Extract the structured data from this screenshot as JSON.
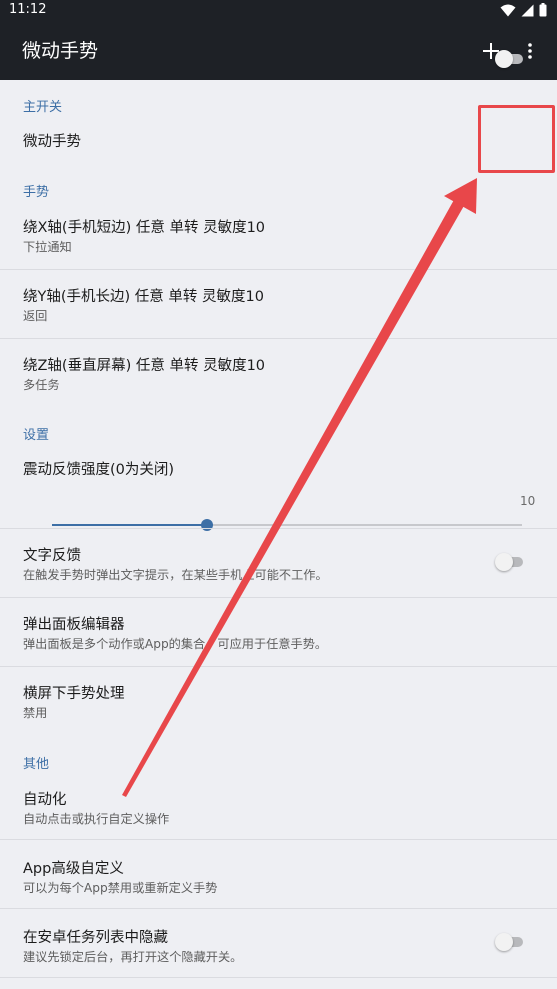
{
  "status_bar": {
    "time": "11:12",
    "icons": [
      "wifi-icon",
      "signal-icon",
      "battery-icon"
    ]
  },
  "app_bar": {
    "title": "微动手势",
    "actions": [
      "add-icon",
      "more-vert-icon"
    ]
  },
  "sections": {
    "main_switch": "主开关",
    "gestures": "手势",
    "settings": "设置",
    "other": "其他"
  },
  "main_switch": {
    "title": "微动手势",
    "on": false
  },
  "gestures": [
    {
      "title": "绕X轴(手机短边) 任意 单转 灵敏度10",
      "subtitle": "下拉通知"
    },
    {
      "title": "绕Y轴(手机长边) 任意 单转 灵敏度10",
      "subtitle": "返回"
    },
    {
      "title": "绕Z轴(垂直屏幕) 任意 单转 灵敏度10",
      "subtitle": "多任务"
    }
  ],
  "vibration": {
    "title": "震动反馈强度(0为关闭)",
    "value_fraction": 0.33,
    "max_label": "10"
  },
  "text_feedback": {
    "title": "文字反馈",
    "subtitle": "在触发手势时弹出文字提示，在某些手机上可能不工作。",
    "on": false
  },
  "popup_editor": {
    "title": "弹出面板编辑器",
    "subtitle": "弹出面板是多个动作或App的集合，可应用于任意手势。"
  },
  "landscape": {
    "title": "横屏下手势处理",
    "subtitle": "禁用"
  },
  "automation": {
    "title": "自动化",
    "subtitle": "自动点击或执行自定义操作"
  },
  "app_custom": {
    "title": "App高级自定义",
    "subtitle": "可以为每个App禁用或重新定义手势"
  },
  "hide_recent": {
    "title": "在安卓任务列表中隐藏",
    "subtitle": "建议先锁定后台，再打开这个隐藏开关。",
    "on": false
  },
  "colors": {
    "accent": "#3d6fa6",
    "toolbar": "#1e2126",
    "annotation": "#e8474a"
  }
}
